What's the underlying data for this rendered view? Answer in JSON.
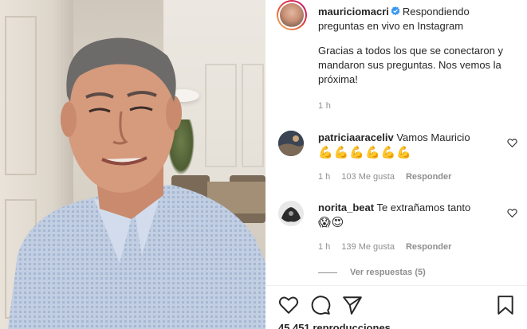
{
  "post": {
    "username": "mauriciomacri",
    "title": "Respondiendo preguntas en vivo en Instagram",
    "body": "Gracias a todos los que se conectaron y mandaron sus preguntas. Nos vemos la próxima!",
    "time": "1 h",
    "views": "45.451 reproducciones"
  },
  "comments": [
    {
      "username": "patriciaaraceliv",
      "text": "Vamos Mauricio",
      "emoji": "💪💪💪💪💪💪",
      "time": "1 h",
      "likes": "103 Me gusta",
      "reply": "Responder"
    },
    {
      "username": "norita_beat",
      "text": "Te extrañamos tanto",
      "emoji": "😱😍",
      "time": "1 h",
      "likes": "139 Me gusta",
      "reply": "Responder"
    }
  ],
  "view_replies": "Ver respuestas (5)",
  "icons": {
    "verified": "verified-badge-icon",
    "like": "heart-icon",
    "comment": "comment-icon",
    "share": "share-icon",
    "save": "bookmark-icon"
  },
  "colors": {
    "verified_blue": "#3897f0",
    "text": "#262626",
    "muted": "#8e8e8e"
  }
}
